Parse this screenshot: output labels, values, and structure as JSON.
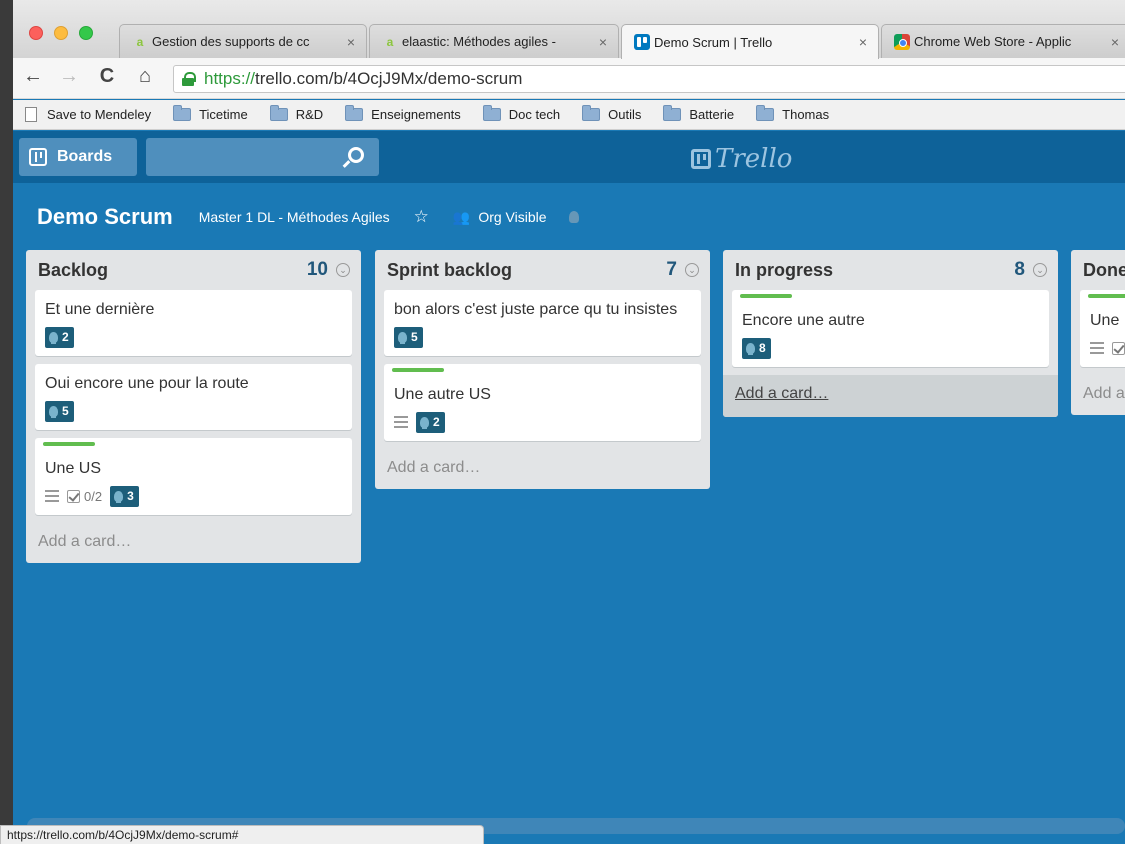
{
  "browser": {
    "tabs": [
      {
        "label": "Gestion des supports de cc",
        "favicon": "elaastic-icon"
      },
      {
        "label": "elaastic: Méthodes agiles -",
        "favicon": "elaastic-icon"
      },
      {
        "label": "Demo Scrum | Trello",
        "favicon": "trello-icon"
      },
      {
        "label": "Chrome Web Store - Applic",
        "favicon": "chrome-web-store-icon"
      }
    ],
    "url_scheme": "https://",
    "url_rest": "trello.com/b/4OcjJ9Mx/demo-scrum",
    "bookmarks": [
      "Save to Mendeley",
      "Ticetime",
      "R&D",
      "Enseignements",
      "Doc tech",
      "Outils",
      "Batterie",
      "Thomas"
    ],
    "status_url": "https://trello.com/b/4OcjJ9Mx/demo-scrum#"
  },
  "header": {
    "boards_label": "Boards",
    "logo_text": "Trello"
  },
  "board": {
    "title": "Demo Scrum",
    "org": "Master 1 DL - Méthodes Agiles",
    "visibility": "Org Visible"
  },
  "lists": [
    {
      "name": "Backlog",
      "count": "10",
      "cards": [
        {
          "title": "Et une dernière",
          "votes": "2"
        },
        {
          "title": "Oui encore une pour la route",
          "votes": "5"
        },
        {
          "title": "Une US",
          "checklist": "0/2",
          "votes": "3"
        }
      ],
      "add_label": "Add a card…"
    },
    {
      "name": "Sprint backlog",
      "count": "7",
      "cards": [
        {
          "title": "bon alors c'est juste parce qu tu insistes",
          "votes": "5"
        },
        {
          "title": "Une autre US",
          "votes": "2"
        }
      ],
      "add_label": "Add a card…"
    },
    {
      "name": "In progress",
      "count": "8",
      "cards": [
        {
          "title": "Encore une autre",
          "votes": "8"
        }
      ],
      "add_label": "Add a card…"
    },
    {
      "name": "Done",
      "cards": [
        {
          "title": "Une"
        }
      ],
      "add_label": "Add a"
    }
  ],
  "colors": {
    "board_bg": "#1a79b5",
    "header_bg": "#0e6299",
    "label_green": "#61bd4f",
    "vote_badge": "#1d5e7a"
  }
}
